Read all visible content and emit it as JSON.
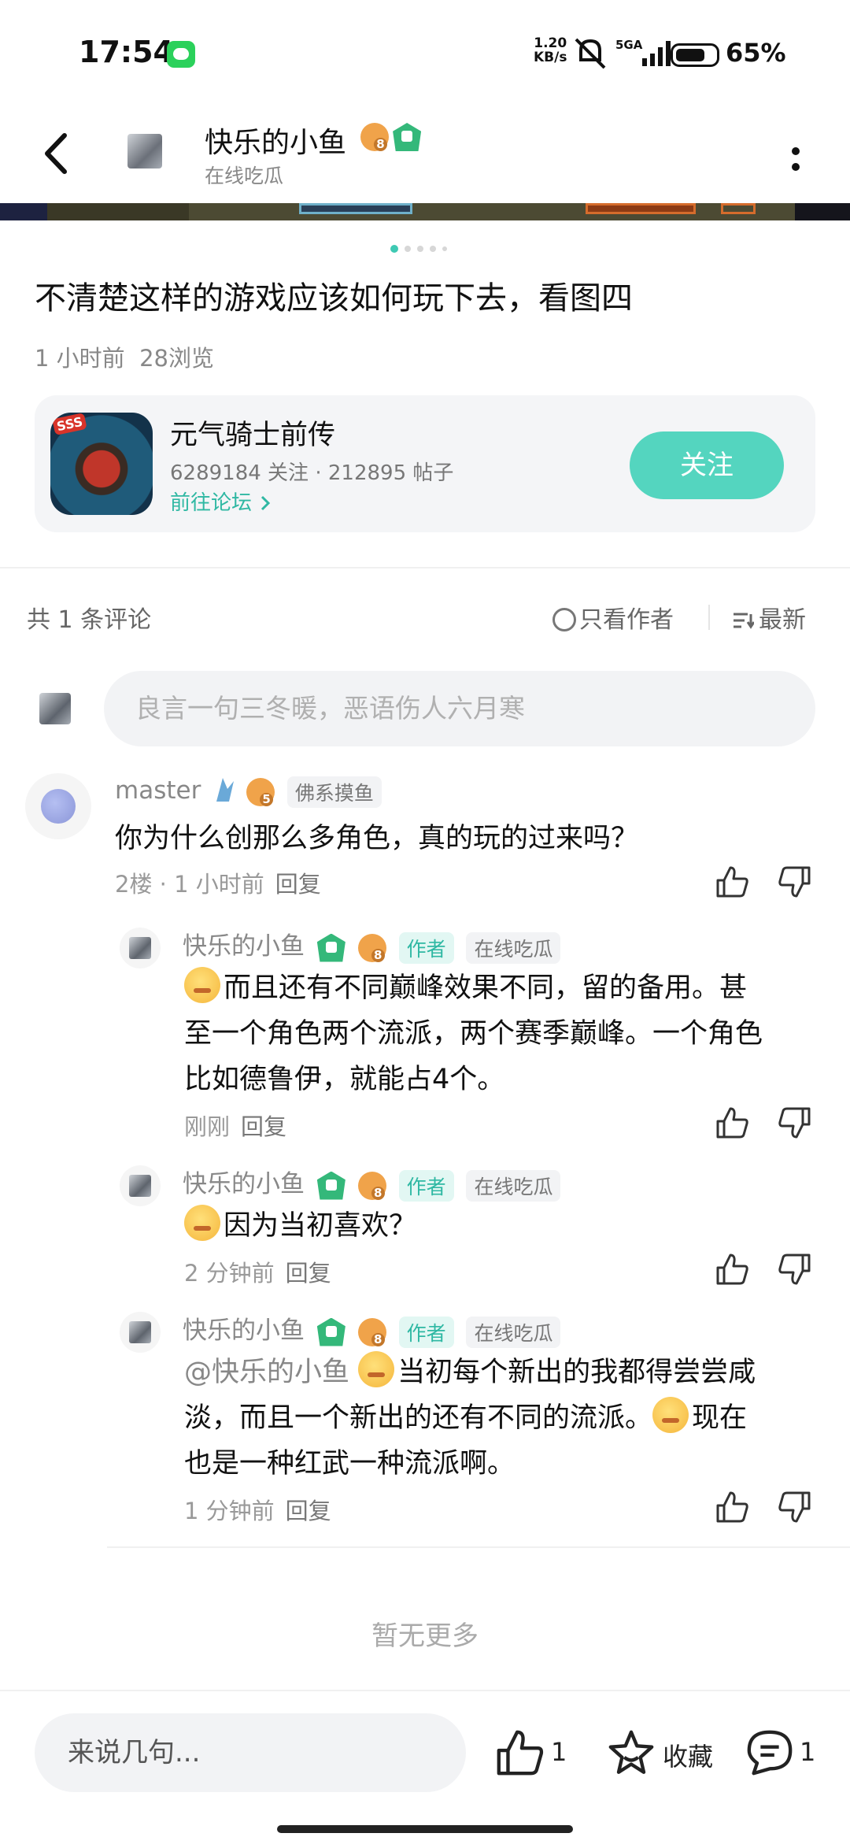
{
  "status_bar": {
    "time": "17:54",
    "net_speed_value": "1.20",
    "net_speed_unit": "KB/s",
    "network": "5GA",
    "battery": "65%"
  },
  "header": {
    "user_name": "快乐的小鱼",
    "user_level": "8",
    "user_subtitle": "在线吃瓜"
  },
  "post": {
    "title": "不清楚这样的游戏应该如何玩下去，看图四",
    "time": "1 小时前",
    "views": "28浏览",
    "image_page_count": 5,
    "image_page_current": 1
  },
  "game_card": {
    "icon_tag": "SSS",
    "name": "元气骑士前传",
    "followers": "6289184 关注",
    "posts": "212895 帖子",
    "link": "前往论坛",
    "follow_button": "关注"
  },
  "comments_header": {
    "count_label": "共 1 条评论",
    "author_only": "只看作者",
    "sort": "最新"
  },
  "comment_input_placeholder": "良言一句三冬暖，恶语伤人六月寒",
  "comment": {
    "user": "master",
    "level": "5",
    "tag": "佛系摸鱼",
    "text": "你为什么创那么多角色，真的玩的过来吗？",
    "floor": "2楼",
    "time": "1 小时前",
    "reply": "回复"
  },
  "replies": [
    {
      "user": "快乐的小鱼",
      "level": "8",
      "author_tag": "作者",
      "tag": "在线吃瓜",
      "lines": [
        "而且还有不同巅峰效果不同，留的备用。甚",
        "至一个角色两个流派，两个赛季巅峰。一个角色",
        "比如德鲁伊，就能占4个。"
      ],
      "time": "刚刚",
      "reply": "回复"
    },
    {
      "user": "快乐的小鱼",
      "level": "8",
      "author_tag": "作者",
      "tag": "在线吃瓜",
      "lines": [
        "因为当初喜欢？"
      ],
      "time": "2 分钟前",
      "reply": "回复"
    },
    {
      "user": "快乐的小鱼",
      "level": "8",
      "author_tag": "作者",
      "tag": "在线吃瓜",
      "mention": "@快乐的小鱼",
      "line1": "当初每个新出的我都得尝尝咸",
      "line2a": "淡，而且一个新出的还有不同的流派。",
      "line2b": "现在",
      "line3": "也是一种红武一种流派啊。",
      "time": "1 分钟前",
      "reply": "回复"
    }
  ],
  "no_more": "暂无更多",
  "bottom_bar": {
    "input_placeholder": "来说几句...",
    "like_count": "1",
    "favorite_label": "收藏",
    "comment_count": "1"
  },
  "colors": {
    "accent": "#54d5bf",
    "link": "#2fb8a3",
    "level_badge": "#f0a34a",
    "trophy": "#34b87a"
  }
}
